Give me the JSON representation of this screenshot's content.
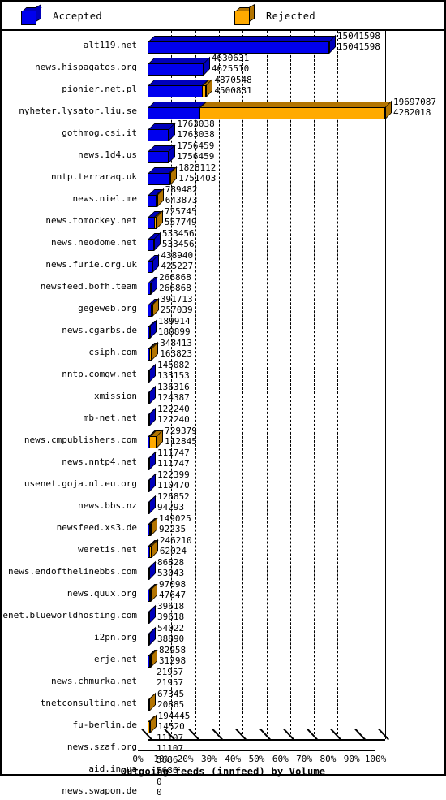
{
  "legend": {
    "accepted": {
      "label": "Accepted",
      "color": "#0000EE",
      "icon": "cube-icon"
    },
    "rejected": {
      "label": "Rejected",
      "color": "#FFAA00",
      "icon": "cube-icon"
    }
  },
  "chart_data": {
    "type": "bar",
    "orientation": "horizontal",
    "stacked": true,
    "title": "Outgoing feeds (innfeed) by Volume",
    "xlabel": "Outgoing feeds (innfeed) by Volume",
    "ylabel": "",
    "xlim": [
      0,
      100
    ],
    "xunit": "%",
    "grid": true,
    "legend_position": "top",
    "xtick_labels": [
      "0%",
      "10%",
      "20%",
      "30%",
      "40%",
      "50%",
      "60%",
      "70%",
      "80%",
      "90%",
      "100%"
    ],
    "xtick_values": [
      0,
      10,
      20,
      30,
      40,
      50,
      60,
      70,
      80,
      90,
      100
    ],
    "series": [
      {
        "name": "Accepted",
        "color": "#0000EE"
      },
      {
        "name": "Rejected",
        "color": "#FFAA00"
      }
    ],
    "categories": [
      "alt119.net",
      "news.hispagatos.org",
      "pionier.net.pl",
      "nyheter.lysator.liu.se",
      "gothmog.csi.it",
      "news.1d4.us",
      "nntp.terraraq.uk",
      "news.niel.me",
      "news.tomockey.net",
      "news.neodome.net",
      "news.furie.org.uk",
      "newsfeed.bofh.team",
      "gegeweb.org",
      "news.cgarbs.de",
      "csiph.com",
      "nntp.comgw.net",
      "xmission",
      "mb-net.net",
      "news.cmpublishers.com",
      "news.nntp4.net",
      "usenet.goja.nl.eu.org",
      "news.bbs.nz",
      "newsfeed.xs3.de",
      "weretis.net",
      "news.endofthelinebbs.com",
      "news.quux.org",
      "usenet.blueworldhosting.com",
      "i2pn.org",
      "erje.net",
      "news.chmurka.net",
      "tnetconsulting.net",
      "fu-berlin.de",
      "news.szaf.org",
      "aid.in.ua",
      "news.swapon.de"
    ],
    "rows": [
      {
        "label": "alt119.net",
        "total": 15041598,
        "accepted": 15041598,
        "total_label": "15041598",
        "accepted_label": "15041598",
        "pct_total": 76.4,
        "pct_accepted": 76.4
      },
      {
        "label": "news.hispagatos.org",
        "total": 4630631,
        "accepted": 4625510,
        "total_label": "4630631",
        "accepted_label": "4625510",
        "pct_total": 23.5,
        "pct_accepted": 23.5
      },
      {
        "label": "pionier.net.pl",
        "total": 4870548,
        "accepted": 4500831,
        "total_label": "4870548",
        "accepted_label": "4500831",
        "pct_total": 24.7,
        "pct_accepted": 22.9
      },
      {
        "label": "nyheter.lysator.liu.se",
        "total": 19697087,
        "accepted": 4282018,
        "total_label": "19697087",
        "accepted_label": "4282018",
        "pct_total": 100.0,
        "pct_accepted": 21.7
      },
      {
        "label": "gothmog.csi.it",
        "total": 1763038,
        "accepted": 1763038,
        "total_label": "1763038",
        "accepted_label": "1763038",
        "pct_total": 9.0,
        "pct_accepted": 9.0
      },
      {
        "label": "news.1d4.us",
        "total": 1756459,
        "accepted": 1756459,
        "total_label": "1756459",
        "accepted_label": "1756459",
        "pct_total": 8.9,
        "pct_accepted": 8.9
      },
      {
        "label": "nntp.terraraq.uk",
        "total": 1828112,
        "accepted": 1751403,
        "total_label": "1828112",
        "accepted_label": "1751403",
        "pct_total": 9.3,
        "pct_accepted": 8.9
      },
      {
        "label": "news.niel.me",
        "total": 789482,
        "accepted": 643873,
        "total_label": "789482",
        "accepted_label": "643873",
        "pct_total": 4.0,
        "pct_accepted": 3.3
      },
      {
        "label": "news.tomockey.net",
        "total": 725745,
        "accepted": 557749,
        "total_label": "725745",
        "accepted_label": "557749",
        "pct_total": 3.7,
        "pct_accepted": 2.8
      },
      {
        "label": "news.neodome.net",
        "total": 533456,
        "accepted": 533456,
        "total_label": "533456",
        "accepted_label": "533456",
        "pct_total": 2.7,
        "pct_accepted": 2.7
      },
      {
        "label": "news.furie.org.uk",
        "total": 438940,
        "accepted": 425227,
        "total_label": "438940",
        "accepted_label": "425227",
        "pct_total": 2.2,
        "pct_accepted": 2.2
      },
      {
        "label": "newsfeed.bofh.team",
        "total": 266868,
        "accepted": 266868,
        "total_label": "266868",
        "accepted_label": "266868",
        "pct_total": 1.4,
        "pct_accepted": 1.4
      },
      {
        "label": "gegeweb.org",
        "total": 391713,
        "accepted": 257039,
        "total_label": "391713",
        "accepted_label": "257039",
        "pct_total": 2.0,
        "pct_accepted": 1.3
      },
      {
        "label": "news.cgarbs.de",
        "total": 189914,
        "accepted": 188899,
        "total_label": "189914",
        "accepted_label": "188899",
        "pct_total": 1.0,
        "pct_accepted": 1.0
      },
      {
        "label": "csiph.com",
        "total": 348413,
        "accepted": 163823,
        "total_label": "348413",
        "accepted_label": "163823",
        "pct_total": 1.8,
        "pct_accepted": 0.8
      },
      {
        "label": "nntp.comgw.net",
        "total": 145082,
        "accepted": 133153,
        "total_label": "145082",
        "accepted_label": "133153",
        "pct_total": 0.7,
        "pct_accepted": 0.7
      },
      {
        "label": "xmission",
        "total": 136316,
        "accepted": 124387,
        "total_label": "136316",
        "accepted_label": "124387",
        "pct_total": 0.7,
        "pct_accepted": 0.6
      },
      {
        "label": "mb-net.net",
        "total": 122240,
        "accepted": 122240,
        "total_label": "122240",
        "accepted_label": "122240",
        "pct_total": 0.6,
        "pct_accepted": 0.6
      },
      {
        "label": "news.cmpublishers.com",
        "total": 729379,
        "accepted": 112845,
        "total_label": "729379",
        "accepted_label": "112845",
        "pct_total": 3.7,
        "pct_accepted": 0.6
      },
      {
        "label": "news.nntp4.net",
        "total": 111747,
        "accepted": 111747,
        "total_label": "111747",
        "accepted_label": "111747",
        "pct_total": 0.6,
        "pct_accepted": 0.6
      },
      {
        "label": "usenet.goja.nl.eu.org",
        "total": 122399,
        "accepted": 110470,
        "total_label": "122399",
        "accepted_label": "110470",
        "pct_total": 0.6,
        "pct_accepted": 0.6
      },
      {
        "label": "news.bbs.nz",
        "total": 126852,
        "accepted": 94293,
        "total_label": "126852",
        "accepted_label": "94293",
        "pct_total": 0.6,
        "pct_accepted": 0.5
      },
      {
        "label": "newsfeed.xs3.de",
        "total": 149025,
        "accepted": 92235,
        "total_label": "149025",
        "accepted_label": "92235",
        "pct_total": 0.8,
        "pct_accepted": 0.5
      },
      {
        "label": "weretis.net",
        "total": 246210,
        "accepted": 62024,
        "total_label": "246210",
        "accepted_label": "62024",
        "pct_total": 1.3,
        "pct_accepted": 0.3
      },
      {
        "label": "news.endofthelinebbs.com",
        "total": 86828,
        "accepted": 53043,
        "total_label": "86828",
        "accepted_label": "53043",
        "pct_total": 0.4,
        "pct_accepted": 0.3
      },
      {
        "label": "news.quux.org",
        "total": 97098,
        "accepted": 47647,
        "total_label": "97098",
        "accepted_label": "47647",
        "pct_total": 0.5,
        "pct_accepted": 0.2
      },
      {
        "label": "usenet.blueworldhosting.com",
        "total": 39618,
        "accepted": 39618,
        "total_label": "39618",
        "accepted_label": "39618",
        "pct_total": 0.2,
        "pct_accepted": 0.2
      },
      {
        "label": "i2pn.org",
        "total": 54022,
        "accepted": 38890,
        "total_label": "54022",
        "accepted_label": "38890",
        "pct_total": 0.3,
        "pct_accepted": 0.2
      },
      {
        "label": "erje.net",
        "total": 82958,
        "accepted": 31298,
        "total_label": "82958",
        "accepted_label": "31298",
        "pct_total": 0.4,
        "pct_accepted": 0.2
      },
      {
        "label": "news.chmurka.net",
        "total": 21957,
        "accepted": 21957,
        "total_label": "21957",
        "accepted_label": "21957",
        "pct_total": 0.1,
        "pct_accepted": 0.1
      },
      {
        "label": "tnetconsulting.net",
        "total": 67345,
        "accepted": 20885,
        "total_label": "67345",
        "accepted_label": "20885",
        "pct_total": 0.3,
        "pct_accepted": 0.1
      },
      {
        "label": "fu-berlin.de",
        "total": 194445,
        "accepted": 14520,
        "total_label": "194445",
        "accepted_label": "14520",
        "pct_total": 1.0,
        "pct_accepted": 0.1
      },
      {
        "label": "news.szaf.org",
        "total": 11107,
        "accepted": 11107,
        "total_label": "11107",
        "accepted_label": "11107",
        "pct_total": 0.06,
        "pct_accepted": 0.06
      },
      {
        "label": "aid.in.ua",
        "total": 5686,
        "accepted": 5686,
        "total_label": "5686",
        "accepted_label": "5686",
        "pct_total": 0.03,
        "pct_accepted": 0.03
      },
      {
        "label": "news.swapon.de",
        "total": 0,
        "accepted": 0,
        "total_label": "0",
        "accepted_label": "0",
        "pct_total": 0.0,
        "pct_accepted": 0.0
      }
    ]
  }
}
